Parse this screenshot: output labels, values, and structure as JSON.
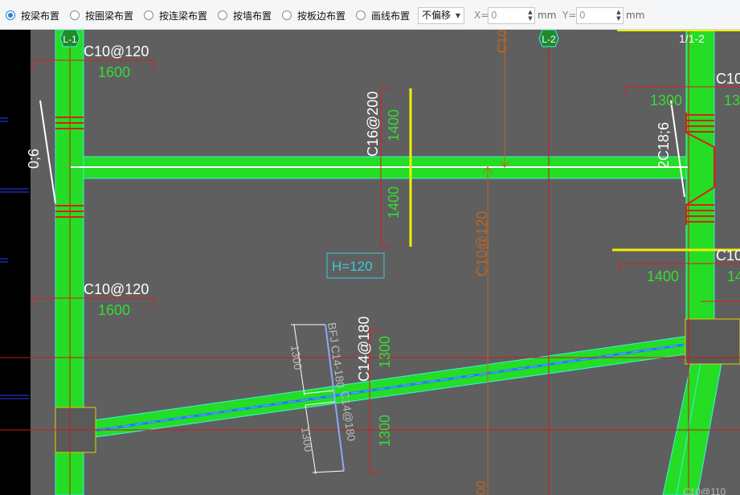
{
  "toolbar": {
    "options": [
      {
        "label": "按梁布置",
        "selected": true
      },
      {
        "label": "按圈梁布置",
        "selected": false
      },
      {
        "label": "按连梁布置",
        "selected": false
      },
      {
        "label": "按墙布置",
        "selected": false
      },
      {
        "label": "按板边布置",
        "selected": false
      },
      {
        "label": "画线布置",
        "selected": false
      }
    ],
    "offset": {
      "value": "不偏移"
    },
    "x": {
      "label": "X=",
      "value": "0",
      "unit": "mm"
    },
    "y": {
      "label": "Y=",
      "value": "0",
      "unit": "mm"
    }
  },
  "drawing": {
    "axes": {
      "left": "L-1",
      "middle": "L-2",
      "right": "1/1-2"
    },
    "labels": {
      "rebar_top": "C10@120",
      "len_top": "1600",
      "rebar_mid": "C10@120",
      "len_mid": "1600",
      "beam_side": "0;6",
      "rebar_vert": "C16@200",
      "len_v1": "1400",
      "len_v2": "1400",
      "rebar_center": "C10@120",
      "rebar_center_top": "C10",
      "slab_thickness": "H=120",
      "beam_right": "2C18;6",
      "rebar_right_top": "C10",
      "len_right_top": "1300",
      "len_right_top2": "130",
      "rebar_right_mid": "C10",
      "len_right_mid": "1400",
      "len_right_mid2": "14",
      "rebar_diag1": "BFJ C14-180",
      "rebar_diag2": "C14@180",
      "rebar_diag3": "C14@180",
      "len_d1": "1300",
      "len_d2": "1300",
      "len_d3": "1300",
      "len_d4": "1300",
      "bottom_cut": "00",
      "bottom_right": "C10@110"
    }
  },
  "colors": {
    "canvas_bg": "#5f5f5f",
    "beam": "#24dd24",
    "beam_edge": "#39f0e8",
    "rebar_green": "#33dd33",
    "rebar_red": "#e01b1b",
    "rebar_orange": "#c0641c",
    "highlight_yellow": "#f0f000",
    "selected_blue": "#1c7dff",
    "slab_cyan": "#3cc8dc"
  }
}
